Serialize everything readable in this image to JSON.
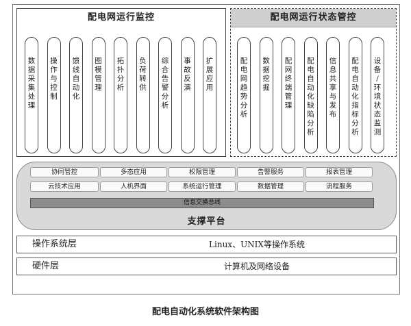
{
  "left_panel": {
    "title": "配电网运行监控",
    "columns": [
      "数据采集处理",
      "操作与控制",
      "馈线自动化",
      "图模管理",
      "拓扑分析",
      "负荷转供",
      "综合告警分析",
      "事故反演",
      "扩展应用"
    ]
  },
  "right_panel": {
    "title": "配电网运行状态管控",
    "columns": [
      "配电网趋势分析",
      "数据挖掘",
      "配网终端管理",
      "配电自动化缺陷分析",
      "信息共享与发布",
      "配电自动化指标分析",
      "设备/环境状态监测"
    ]
  },
  "support": {
    "row1": [
      "协同管控",
      "多态应用",
      "权限管理",
      "告警服务",
      "报表管理"
    ],
    "row2": [
      "云技术应用",
      "人机界面",
      "系统运行管理",
      "数据管理",
      "流程服务"
    ],
    "bus": "信息交换总线",
    "title": "支撑平台"
  },
  "os_layer": {
    "label": "操作系统层",
    "desc": "Linux、UNIX等操作系统"
  },
  "hw_layer": {
    "label": "硬件层",
    "desc": "计算机及网络设备"
  },
  "caption": "配电自动化系统软件架构图"
}
